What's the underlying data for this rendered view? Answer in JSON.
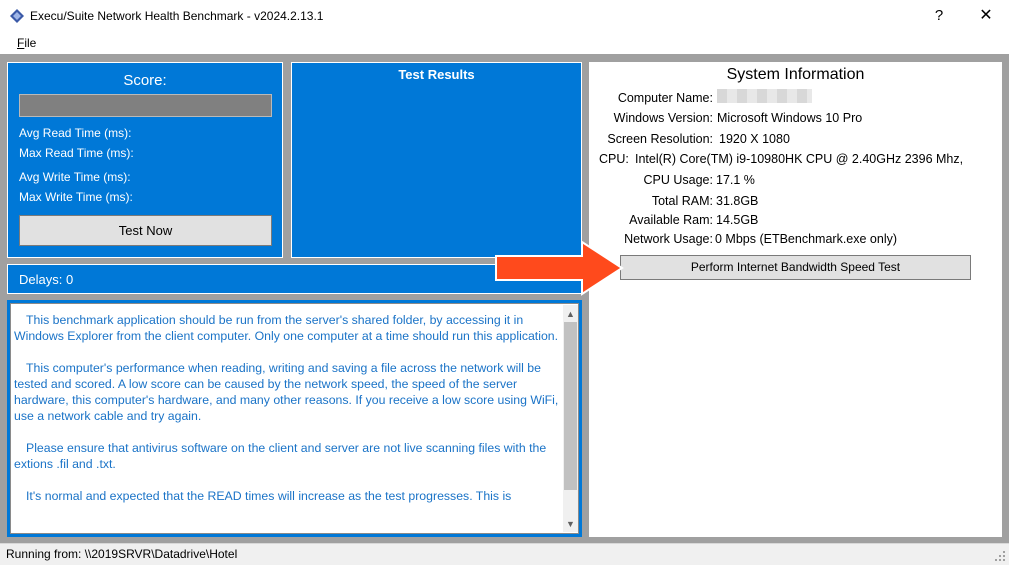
{
  "window": {
    "title": "Execu/Suite Network Health Benchmark - v2024.2.13.1",
    "help_glyph": "?",
    "close_glyph": "✕"
  },
  "menu": {
    "file_accel": "F",
    "file_rest": "ile"
  },
  "score_panel": {
    "title": "Score:",
    "avg_read": "Avg Read Time (ms):",
    "max_read": "Max Read Time (ms):",
    "avg_write": "Avg Write Time (ms):",
    "max_write": "Max Write Time (ms):",
    "test_button": "Test Now"
  },
  "results_panel": {
    "title": "Test Results"
  },
  "delays": {
    "text": "Delays: 0"
  },
  "info": {
    "paragraphs": [
      "This benchmark application should be run from the server's shared folder, by accessing it in Windows Explorer from the client computer. Only one computer at a time should run this application.",
      "This computer's performance when reading, writing and saving a file across the network will be tested and scored. A low score can be caused by the network speed, the speed of the server hardware, this computer's hardware, and many other reasons. If you receive a low score  using WiFi, use a network cable and try again.",
      "Please ensure that antivirus software on the client and server are not live scanning files with the extions .fil and .txt.",
      "It's normal and expected that the READ times will increase as the test progresses. This is"
    ]
  },
  "system_info": {
    "title": "System Information",
    "computer_name_label": "Computer Name:",
    "windows_version_label": "Windows Version:",
    "windows_version": "Microsoft Windows 10 Pro",
    "screen_resolution_label": "Screen Resolution:",
    "screen_resolution": "1920 X 1080",
    "cpu_label": "CPU:",
    "cpu": "Intel(R) Core(TM) i9-10980HK CPU @ 2.40GHz 2396 Mhz,",
    "cpu_usage_label": "CPU Usage:",
    "cpu_usage": "17.1 %",
    "total_ram_label": "Total RAM:",
    "total_ram": "31.8GB",
    "available_ram_label": "Available Ram:",
    "available_ram": "14.5GB",
    "network_usage_label": "Network Usage:",
    "network_usage": "0 Mbps (ETBenchmark.exe only)",
    "speed_test_button": "Perform Internet Bandwidth Speed Test"
  },
  "status_bar": {
    "text": "Running from: \\\\2019SRVR\\Datadrive\\Hotel"
  },
  "colors": {
    "panel_blue": "#0078d7",
    "info_text": "#1a73c7",
    "arrow": "#ff4a1c"
  },
  "icons": {
    "app": "app-icon",
    "arrow": "red-arrow-annotation",
    "grip": "resize-grip-icon"
  }
}
